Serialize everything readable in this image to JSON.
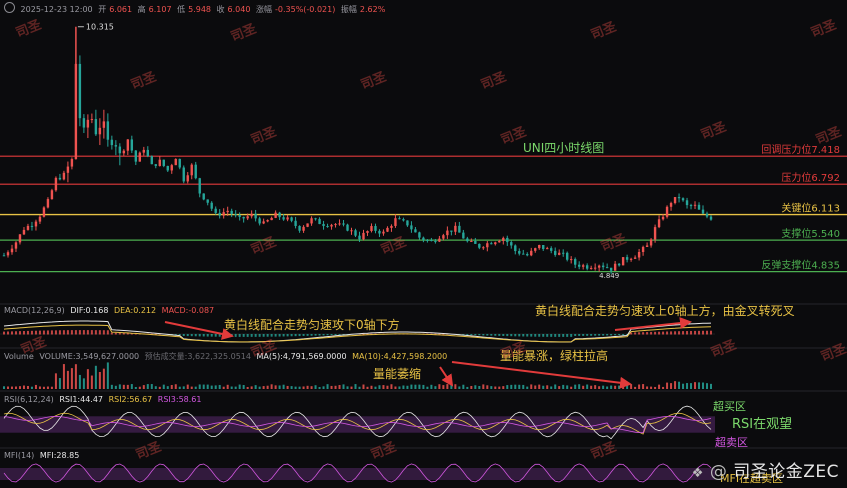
{
  "header": {
    "date": "2025-12-23 12:00",
    "open_label": "开",
    "open": "6.061",
    "high_label": "高",
    "high": "6.107",
    "low_label": "低",
    "low": "5.948",
    "close_label": "收",
    "close": "6.040",
    "change_label": "涨幅",
    "change": "-0.35%(-0.021)",
    "amplitude_label": "振幅",
    "amplitude": "2.62%"
  },
  "indicators": {
    "macd": {
      "label": "MACD(12,26,9)",
      "dif": "DIF:0.168",
      "dea": "DEA:0.212",
      "macd": "MACD:-0.087"
    },
    "volume": {
      "label": "Volume",
      "volume": "VOLUME:3,549,627.0000",
      "vol2": "预估成交量:3,622,325.0514",
      "ma5": "MA(5):4,791,569.0000",
      "ma10": "MA(10):4,427,598.2000"
    },
    "rsi": {
      "label": "RSI(6,12,24)",
      "rsi1": "RSI1:44.47",
      "rsi2": "RSI2:56.67",
      "rsi3": "RSI3:58.61"
    },
    "mfi": {
      "label": "MFI(14)",
      "mfi": "MFI:28.85"
    }
  },
  "annotations": {
    "title": "UNI四小时线图",
    "high_marker": "10.315",
    "low_marker": "4.849",
    "macd_left": "黄白线配合走势匀速攻下0轴下方",
    "macd_right": "黄白线配合走势匀速攻上0轴上方，由金叉转死叉",
    "vol_explode": "量能暴涨，绿柱拉高",
    "vol_shrink": "量能萎缩",
    "overbought": "超买区",
    "rsi_watch": "RSI在观望",
    "oversold": "超卖区",
    "mfi_oversold": "MFI在超卖区"
  },
  "watermark": "司圣",
  "logo": "司圣论金ZEC",
  "colors": {
    "up": "#ef5350",
    "down": "#26a69a",
    "resistance": "#e23b3b",
    "key": "#e8c245",
    "support": "#4caf50",
    "dif": "#e8e8e8",
    "dea": "#e8c245",
    "rsi_band": "#5a2a6e"
  },
  "chart_data": {
    "type": "candlestick",
    "title": "UNI四小时线图",
    "ylim": [
      4.2,
      10.6
    ],
    "levels": [
      {
        "label": "回调压力位7.418",
        "value": 7.418,
        "kind": "resistance"
      },
      {
        "label": "压力位6.792",
        "value": 6.792,
        "kind": "resistance"
      },
      {
        "label": "关键位6.113",
        "value": 6.113,
        "kind": "key"
      },
      {
        "label": "支撑位5.540",
        "value": 5.54,
        "kind": "support"
      },
      {
        "label": "反弹支撑位4.835",
        "value": 4.835,
        "kind": "support"
      }
    ],
    "price_path": [
      [
        0,
        5.2
      ],
      [
        6,
        5.5
      ],
      [
        10,
        5.8
      ],
      [
        14,
        5.9
      ],
      [
        18,
        6.1
      ],
      [
        22,
        6.4
      ],
      [
        26,
        6.9
      ],
      [
        30,
        7.0
      ],
      [
        34,
        7.3
      ],
      [
        36,
        9.5
      ],
      [
        38,
        8.3
      ],
      [
        40,
        7.9
      ],
      [
        43,
        8.4
      ],
      [
        46,
        8.0
      ],
      [
        49,
        8.2
      ],
      [
        52,
        7.7
      ],
      [
        55,
        7.9
      ],
      [
        58,
        7.4
      ],
      [
        62,
        7.8
      ],
      [
        66,
        7.3
      ],
      [
        70,
        7.6
      ],
      [
        74,
        7.2
      ],
      [
        78,
        7.3
      ],
      [
        82,
        7.1
      ],
      [
        86,
        7.4
      ],
      [
        90,
        6.9
      ],
      [
        94,
        7.2
      ],
      [
        98,
        6.6
      ],
      [
        102,
        6.4
      ],
      [
        106,
        6.1
      ],
      [
        112,
        6.2
      ],
      [
        118,
        6.0
      ],
      [
        124,
        6.1
      ],
      [
        130,
        5.9
      ],
      [
        136,
        6.1
      ],
      [
        142,
        6.0
      ],
      [
        148,
        5.8
      ],
      [
        154,
        6.0
      ],
      [
        160,
        5.9
      ],
      [
        166,
        5.9
      ],
      [
        172,
        5.8
      ],
      [
        178,
        5.6
      ],
      [
        184,
        5.8
      ],
      [
        190,
        5.7
      ],
      [
        196,
        6.0
      ],
      [
        202,
        5.9
      ],
      [
        208,
        5.6
      ],
      [
        214,
        5.5
      ],
      [
        220,
        5.7
      ],
      [
        226,
        5.8
      ],
      [
        232,
        5.5
      ],
      [
        238,
        5.4
      ],
      [
        244,
        5.5
      ],
      [
        250,
        5.6
      ],
      [
        256,
        5.3
      ],
      [
        262,
        5.2
      ],
      [
        268,
        5.4
      ],
      [
        274,
        5.3
      ],
      [
        280,
        5.2
      ],
      [
        286,
        5.0
      ],
      [
        292,
        4.95
      ],
      [
        298,
        5.0
      ],
      [
        304,
        4.9
      ],
      [
        310,
        5.1
      ],
      [
        316,
        5.2
      ],
      [
        322,
        5.4
      ],
      [
        326,
        5.8
      ],
      [
        330,
        6.1
      ],
      [
        334,
        6.4
      ],
      [
        338,
        6.5
      ],
      [
        342,
        6.3
      ],
      [
        346,
        6.3
      ],
      [
        350,
        6.1
      ],
      [
        354,
        6.04
      ]
    ],
    "rsi_overbought": 70,
    "rsi_oversold": 30
  }
}
